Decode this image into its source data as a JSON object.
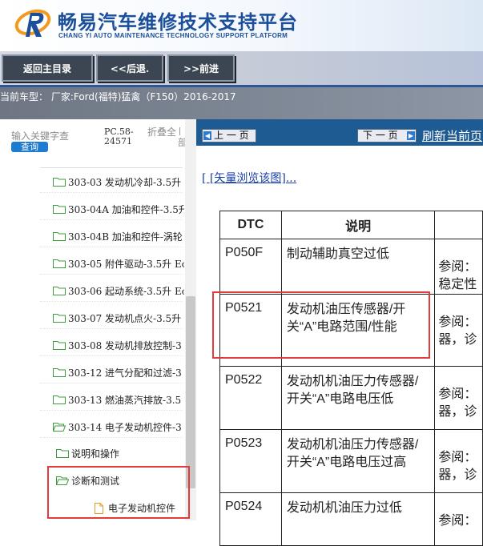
{
  "header": {
    "brand_cn": "畅易汽车维修技术支持平台",
    "brand_en": "CHANG YI AUTO MAINTENANCE TECHNOLOGY SUPPORT PLATFORM",
    "brand_color": "#1b4f9c"
  },
  "toolbar": {
    "home_label": "返回主目录",
    "back_label": "<<后退.",
    "forward_label": ">>前进"
  },
  "car_info": "当前车型： 厂家:Ford(福特)猛禽（F150）2016-2017",
  "left_panel": {
    "search_placeholder": "输入关键字查",
    "query_label": "查询",
    "pc_code_1": "PC.58-",
    "pc_code_2": "24571",
    "fold_1": "折叠全",
    "fold_2": "部",
    "tree": [
      {
        "label": "303-03 发动机冷却-3.5升",
        "icon": "folder-icon"
      },
      {
        "label": "303-04A 加油和控件-3.5升",
        "icon": "folder-icon"
      },
      {
        "label": "303-04B 加油和控件-涡轮",
        "icon": "folder-icon"
      },
      {
        "label": "303-05 附件驱动-3.5升 Ec",
        "icon": "folder-icon"
      },
      {
        "label": "303-06 起动系统-3.5升 Ec",
        "icon": "folder-icon"
      },
      {
        "label": "303-07 发动机点火-3.5升",
        "icon": "folder-icon"
      },
      {
        "label": "303-08 发动机排放控制-3",
        "icon": "folder-icon"
      },
      {
        "label": "303-12 进气分配和过滤-3",
        "icon": "folder-icon"
      },
      {
        "label": "303-13 燃油蒸汽排放-3.5",
        "icon": "folder-icon"
      },
      {
        "label": "303-14 电子发动机控件-3",
        "icon": "folder-open-icon"
      },
      {
        "label": "说明和操作",
        "icon": "folder-icon"
      },
      {
        "label": "诊断和测试",
        "icon": "folder-open-icon"
      },
      {
        "label": "电子发动机控件",
        "icon": "document-icon"
      }
    ]
  },
  "right_panel": {
    "prev_page": "上 一 页",
    "next_page": "下 一 页",
    "refresh": "刷新当前页",
    "vector_link": "[ [矢量浏览该图]...",
    "table": {
      "headers": [
        "DTC",
        "说明",
        ""
      ],
      "rows": [
        {
          "code": "P050F",
          "desc": "制动辅助真空过低",
          "ref": "参阅：\n稳定性"
        },
        {
          "code": "P0521",
          "desc": "发动机油压传感器/开关“A”电路范围/性能",
          "ref": "参阅：\n器，诊"
        },
        {
          "code": "P0522",
          "desc": "发动机机油压力传感器/开关“A”电路电压低",
          "ref": "参阅：\n器，诊"
        },
        {
          "code": "P0523",
          "desc": "发动机机油压力传感器/开关“A”电路电压过高",
          "ref": "参阅：\n器，诊"
        },
        {
          "code": "P0524",
          "desc": "发动机机油压力过低",
          "ref": "参阅："
        }
      ]
    }
  },
  "colors": {
    "toolbar_button": "#3c4653",
    "nav_bar": "#1f5b93",
    "highlight": "#e23b3b",
    "link": "#1a3fa8"
  }
}
